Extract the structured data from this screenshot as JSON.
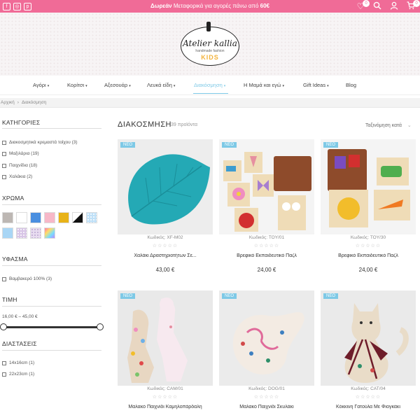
{
  "topbar": {
    "promo_bold": "Δωρεάν",
    "promo_text": " Μεταφορικά για αγορές πάνω από ",
    "promo_amount": "60€",
    "wishlist_count": "0",
    "cart_count": "0",
    "social_icons": [
      "facebook-icon",
      "instagram-icon",
      "pinterest-icon"
    ]
  },
  "logo": {
    "title": "Atelier kallia",
    "subtitle": "handmade fashion",
    "kids": "KIDS"
  },
  "nav": [
    {
      "label": "Αγόρι",
      "caret": "▾"
    },
    {
      "label": "Κορίτσι",
      "caret": "▾"
    },
    {
      "label": "Αξεσουάρ",
      "caret": "▾"
    },
    {
      "label": "Λευκά είδη",
      "caret": "▾"
    },
    {
      "label": "Διακόσμηση",
      "caret": "▾",
      "active": true
    },
    {
      "label": "Η Μαμά και εγώ",
      "caret": "▾"
    },
    {
      "label": "Gift Ideas",
      "caret": "▾"
    },
    {
      "label": "Blog",
      "caret": ""
    }
  ],
  "breadcrumb": {
    "home": "Αρχική",
    "sep": "›",
    "current": "Διακόσμηση"
  },
  "sidebar": {
    "categories_title": "ΚΑΤΗΓΟΡΙΕΣ",
    "categories": [
      {
        "label": "Διακοσμητικά κρεμαστά τοίχου",
        "count": "(3)"
      },
      {
        "label": "Μαξιλάρια",
        "count": "(19)"
      },
      {
        "label": "Παιχνίδια",
        "count": "(18)"
      },
      {
        "label": "Χαλάκια",
        "count": "(2)"
      }
    ],
    "color_title": "ΧΡΩΜΑ",
    "swatches": [
      "#bdb7b3",
      "#ffffff",
      "#4a8fe0",
      "#f7b8c8",
      "#e8b318",
      "black-white-diagonal",
      "#bfe0f7",
      "#a9d6f5",
      "#d8c5e6",
      "#e8dcf0",
      "rainbow"
    ],
    "fabric_title": "ΥΦΑΣΜΑ",
    "fabrics": [
      {
        "label": "Βαμβακερό 100%",
        "count": "(3)"
      }
    ],
    "price_title": "ΤΙΜΗ",
    "price_range": "16,00 € – 45,00 €",
    "price_min": "16,00 €",
    "price_max": "45,00 €",
    "size_title": "ΔΙΑΣΤΑΣΕΙΣ",
    "sizes": [
      {
        "label": "14x16cm",
        "count": "(1)"
      },
      {
        "label": "22x23cm",
        "count": "(1)"
      }
    ]
  },
  "main": {
    "title": "ΔΙΑΚΟΣΜΗΣΗ",
    "count": "39 προϊόντα",
    "sort_label": "Ταξινόμηση κατά",
    "sort_chevron": "⌄"
  },
  "products": [
    {
      "badge": "NEO",
      "code": "Κωδικός: XF-M02",
      "name": "Χαλάκι Δραστηριοτήτων Σε...",
      "price": "43,00 €",
      "stars": "☆☆☆☆☆",
      "image": "teal-leaf-mat"
    },
    {
      "badge": "NEO",
      "code": "Κωδικός: TOY/01",
      "name": "Βρεφικό Εκπαιδευτικό Παζλ",
      "price": "24,00 €",
      "stars": "☆☆☆☆☆",
      "image": "fabric-puzzle-cards"
    },
    {
      "badge": "NEO",
      "code": "Κωδικός: TOY/30",
      "name": "Βρεφικό Εκπαιδευτικό Παζλ",
      "price": "24,00 €",
      "stars": "☆☆☆☆☆",
      "image": "fabric-puzzle-cards-2"
    },
    {
      "badge": "NEO",
      "code": "Κωδικός: CAM/01",
      "name": "Μαλακό Παιχνίδι Καμηλοπάρδαλη",
      "price": "",
      "stars": "☆☆☆☆☆",
      "image": "giraffe-toys"
    },
    {
      "badge": "NEO",
      "code": "Κωδικός: DOG/01",
      "name": "Μαλακό Παιχνίδι Σκυλάκι",
      "price": "",
      "stars": "☆☆☆☆☆",
      "image": "dog-toy"
    },
    {
      "badge": "NEO",
      "code": "Κωδικός: CAT/04",
      "name": "Κόκκινη Γατούλα Με Φιογκάκι",
      "price": "",
      "stars": "☆☆☆☆☆",
      "image": "cat-toy"
    }
  ]
}
